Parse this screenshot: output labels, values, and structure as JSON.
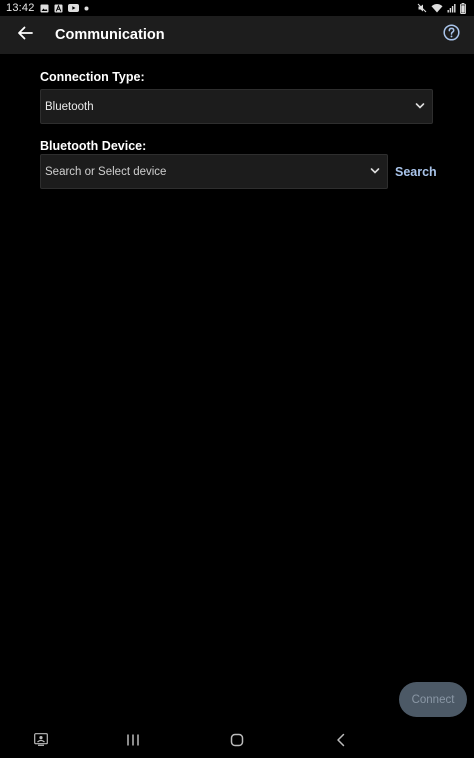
{
  "status_bar": {
    "time": "13:42",
    "icons_left": [
      "image-icon",
      "text-a-icon",
      "youtube-icon",
      "dot-icon"
    ],
    "icons_right": [
      "mute-icon",
      "wifi-icon",
      "signal-icon",
      "battery-icon"
    ]
  },
  "app_bar": {
    "title": "Communication",
    "back_icon": "arrow-left-icon",
    "help_icon": "help-circle-icon"
  },
  "connection_type": {
    "label": "Connection Type:",
    "value": "Bluetooth"
  },
  "bluetooth_device": {
    "label": "Bluetooth Device:",
    "placeholder": "Search or Select device",
    "search_label": "Search"
  },
  "connect_button": {
    "label": "Connect",
    "enabled": false
  },
  "nav_bar": {
    "items": [
      "screenshot-icon",
      "recent-apps-icon",
      "home-icon",
      "back-icon"
    ]
  },
  "colors": {
    "background": "#000000",
    "app_bar": "#1d1d1d",
    "field_bg": "#1c1c1c",
    "accent_link": "#a9c4ea",
    "button_disabled_bg": "#4c5966"
  }
}
